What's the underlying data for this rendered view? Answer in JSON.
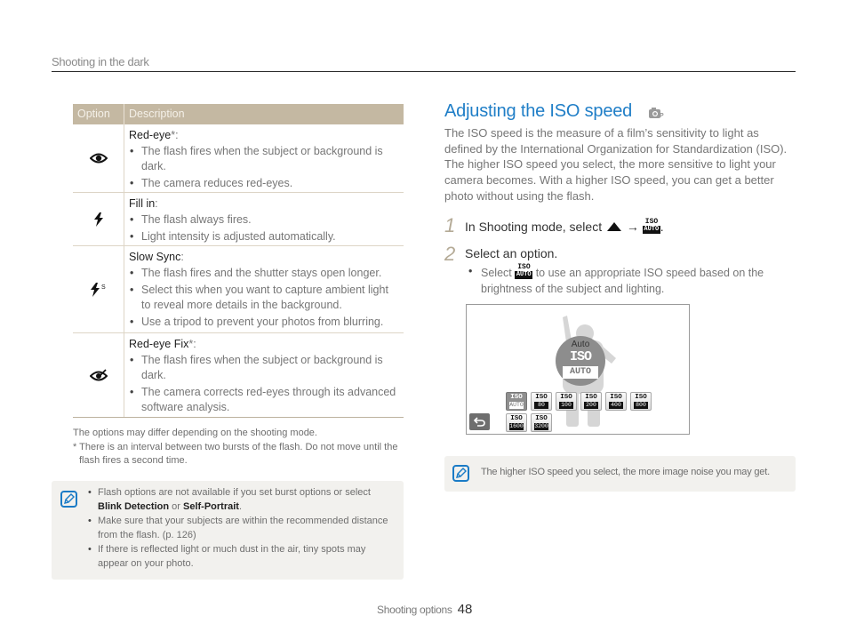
{
  "header": {
    "section_title": "Shooting in the dark"
  },
  "options_table": {
    "columns": [
      "Option",
      "Description"
    ],
    "rows": [
      {
        "icon": "red-eye-icon",
        "title": "Red-eye",
        "title_suffix": "*:",
        "bullets": [
          "The flash fires when the subject or background is dark.",
          "The camera reduces red-eyes."
        ]
      },
      {
        "icon": "fill-in-flash-icon",
        "title": "Fill in",
        "title_suffix": ":",
        "bullets": [
          "The flash always fires.",
          "Light intensity is adjusted automatically."
        ]
      },
      {
        "icon": "slow-sync-flash-icon",
        "title": "Slow Sync",
        "title_suffix": ":",
        "bullets": [
          "The flash fires and the shutter stays open longer.",
          "Select this when you want to capture ambient light to reveal more details in the background.",
          "Use a tripod to prevent your photos from blurring."
        ]
      },
      {
        "icon": "red-eye-fix-icon",
        "title": "Red-eye Fix",
        "title_suffix": "*:",
        "bullets": [
          "The flash fires when the subject or background is dark.",
          "The camera corrects red-eyes through its advanced software analysis."
        ]
      }
    ]
  },
  "footnotes": {
    "line1": "The options may differ depending on the shooting mode.",
    "line2": "* There is an interval between two bursts of the flash. Do not move until the flash fires a second time."
  },
  "left_note": {
    "icon": "note-pencil-icon",
    "items": [
      {
        "pre": "Flash options are not available if you set burst options or select ",
        "b1": "Blink Detection",
        "mid": " or ",
        "b2": "Self-Portrait",
        "post": "."
      },
      {
        "text": "Make sure that your subjects are within the recommended distance from the flash. (p. 126)"
      },
      {
        "text": "If there is reflected light or much dust in the air, tiny spots may appear on your photo."
      }
    ]
  },
  "iso_section": {
    "title": "Adjusting the ISO speed",
    "mode_icon": "camera-program-mode-icon",
    "intro": "The ISO speed is the measure of a film’s sensitivity to light as defined by the International Organization for Standardization (ISO). The higher ISO speed you select, the more sensitive to light your camera becomes. With a higher ISO speed, you can get a better photo without using the flash.",
    "steps": [
      {
        "num": "1",
        "text_before": "In Shooting mode, select ",
        "arrow": "→",
        "text_after": "."
      },
      {
        "num": "2",
        "text": "Select an option.",
        "sub_before": "Select ",
        "sub_after": " to use an appropriate ISO speed based on the brightness of the subject and lighting."
      }
    ],
    "iso_glyph": {
      "top": "ISO",
      "bottom": "AUTO"
    }
  },
  "camera_screen": {
    "preview_label": "Auto",
    "preview_iso": "ISO",
    "preview_value": "AUTO",
    "options": [
      {
        "label": "ISO",
        "value": "AUTO",
        "selected": true
      },
      {
        "label": "ISO",
        "value": "80",
        "selected": false
      },
      {
        "label": "ISO",
        "value": "100",
        "selected": false
      },
      {
        "label": "ISO",
        "value": "200",
        "selected": false
      },
      {
        "label": "ISO",
        "value": "400",
        "selected": false
      },
      {
        "label": "ISO",
        "value": "800",
        "selected": false
      },
      {
        "label": "ISO",
        "value": "1600",
        "selected": false
      },
      {
        "label": "ISO",
        "value": "3200",
        "selected": false
      }
    ],
    "back_icon": "back-arrow-icon"
  },
  "right_note": {
    "text": "The higher ISO speed you select, the more image noise you may get."
  },
  "footer": {
    "section": "Shooting options",
    "page": "48"
  },
  "colors": {
    "accent": "#1f7ec7",
    "table_header": "#c4b8a2",
    "note_bg": "#f2f1ee"
  }
}
